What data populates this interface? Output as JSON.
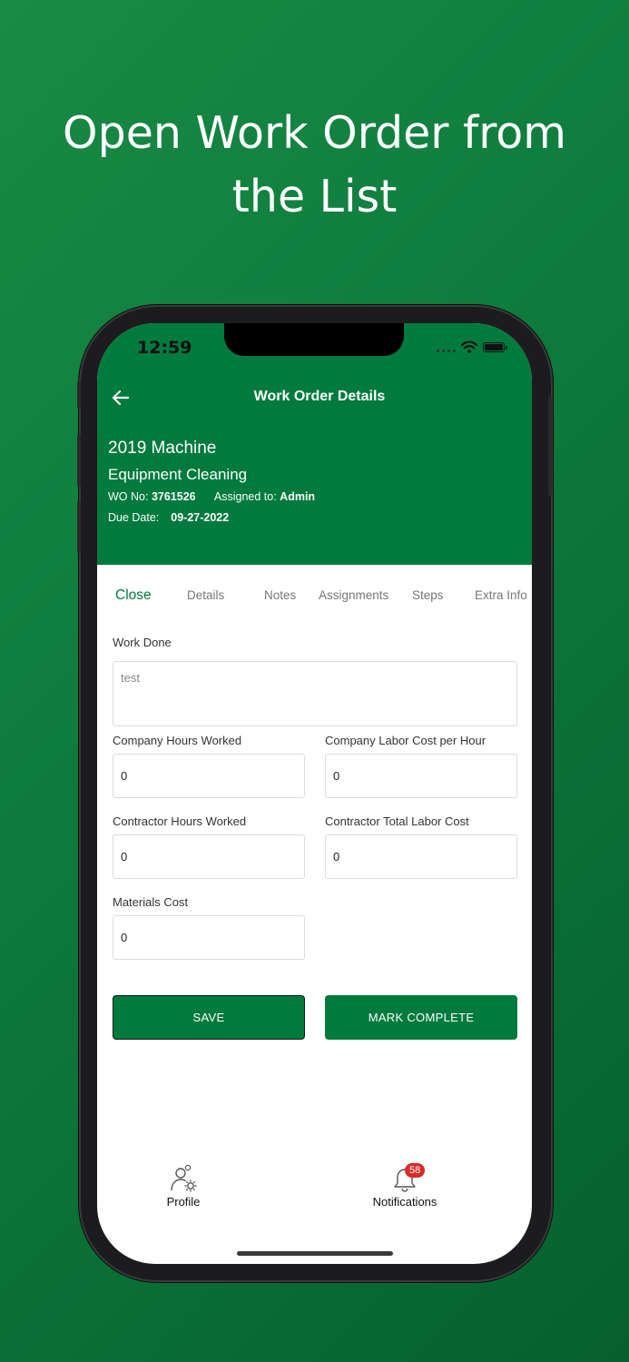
{
  "headline": {
    "line1": "Open Work Order from",
    "line2": "the List"
  },
  "status_bar": {
    "time": "12:59"
  },
  "app_bar": {
    "title": "Work Order Details"
  },
  "work_order": {
    "title": "2019 Machine",
    "subtitle": "Equipment Cleaning",
    "wo_no_label": "WO No:",
    "wo_no": "3761526",
    "assigned_label": "Assigned to:",
    "assigned_to": "Admin",
    "due_label": "Due Date:",
    "due_date": "09-27-2022"
  },
  "tabs": [
    {
      "label": "Close",
      "active": true
    },
    {
      "label": "Details",
      "active": false
    },
    {
      "label": "Notes",
      "active": false
    },
    {
      "label": "Assignments",
      "active": false
    },
    {
      "label": "Steps",
      "active": false
    },
    {
      "label": "Extra Info",
      "active": false
    }
  ],
  "form": {
    "work_done": {
      "label": "Work Done",
      "value": "test"
    },
    "company_hours": {
      "label": "Company Hours Worked",
      "value": "0"
    },
    "company_labor_cost": {
      "label": "Company Labor Cost per Hour",
      "value": "0"
    },
    "contractor_hours": {
      "label": "Contractor Hours Worked",
      "value": "0"
    },
    "contractor_total_cost": {
      "label": "Contractor Total Labor Cost",
      "value": "0"
    },
    "materials_cost": {
      "label": "Materials Cost",
      "value": "0"
    }
  },
  "buttons": {
    "save": "SAVE",
    "mark_complete": "MARK COMPLETE"
  },
  "bottom_nav": {
    "profile": {
      "label": "Profile",
      "icon": "profile-gear-icon"
    },
    "notifications": {
      "label": "Notifications",
      "icon": "bell-icon",
      "badge": "58"
    }
  },
  "colors": {
    "brand_green": "#007a3d",
    "badge_red": "#d72b2b",
    "background": "#0d7a3c"
  }
}
